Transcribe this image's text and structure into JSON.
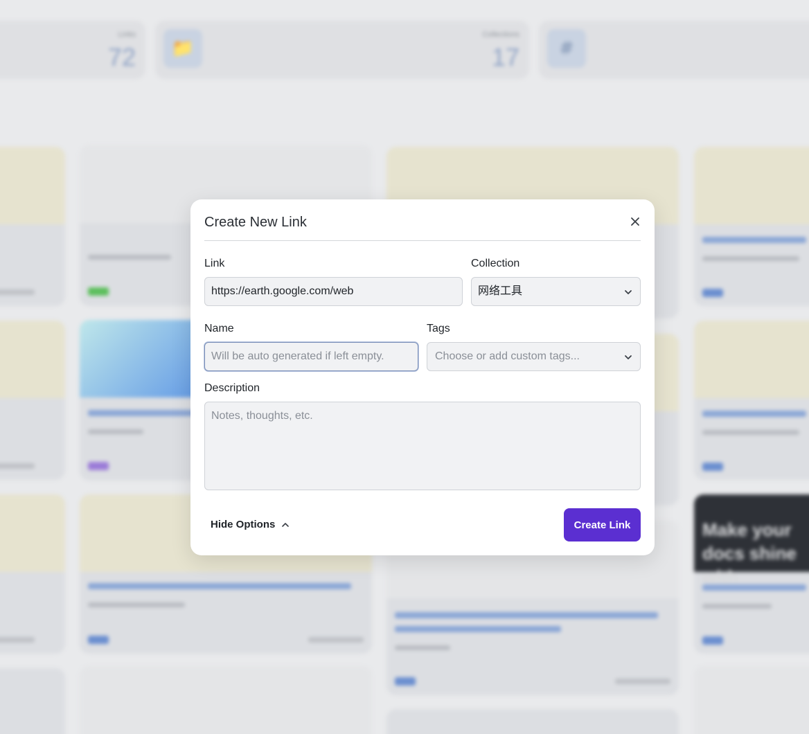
{
  "background": {
    "stats": [
      {
        "label": "Links",
        "value": "72"
      },
      {
        "label": "Collections",
        "value": "17"
      },
      {
        "label": "Tags",
        "value": ""
      }
    ],
    "cards": [
      {
        "title": "Make your docs shine with"
      }
    ]
  },
  "modal": {
    "title": "Create New Link",
    "link": {
      "label": "Link",
      "value": "https://earth.google.com/web"
    },
    "collection": {
      "label": "Collection",
      "value": "网络工具"
    },
    "name": {
      "label": "Name",
      "placeholder": "Will be auto generated if left empty."
    },
    "tags": {
      "label": "Tags",
      "placeholder": "Choose or add custom tags..."
    },
    "description": {
      "label": "Description",
      "placeholder": "Notes, thoughts, etc."
    },
    "hide_options": "Hide Options",
    "create_button": "Create Link"
  },
  "colors": {
    "accent": "#5b2fd1",
    "background": "#e9eaec"
  },
  "icons": {
    "close": "close-icon",
    "dropdown": "chevron-down-icon",
    "collapse": "chevron-up-icon"
  }
}
